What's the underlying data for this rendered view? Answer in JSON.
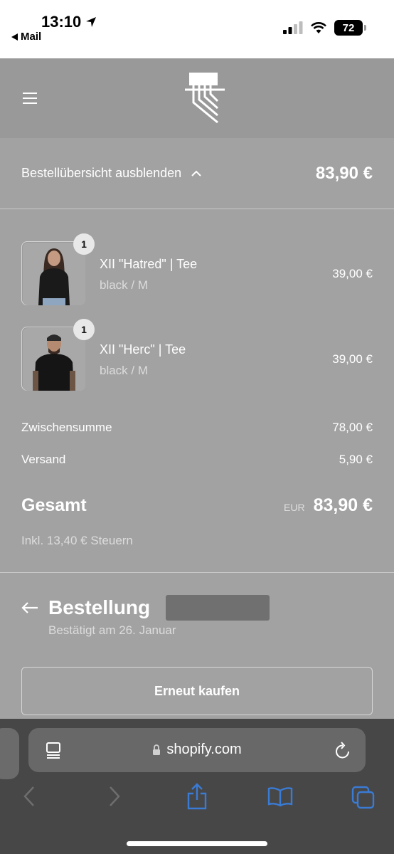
{
  "status_bar": {
    "time": "13:10",
    "back_app": "Mail",
    "battery": "72"
  },
  "header": {
    "menu_icon": "hamburger-icon",
    "logo": "brand-logo"
  },
  "summary": {
    "toggle_label": "Bestellübersicht ausblenden",
    "total": "83,90 €"
  },
  "items": [
    {
      "quantity": "1",
      "name": "XII \"Hatred\" | Tee",
      "variant": "black / M",
      "price": "39,00 €"
    },
    {
      "quantity": "1",
      "name": "XII \"Herc\" | Tee",
      "variant": "black / M",
      "price": "39,00 €"
    }
  ],
  "totals": {
    "subtotal_label": "Zwischensumme",
    "subtotal_value": "78,00 €",
    "shipping_label": "Versand",
    "shipping_value": "5,90 €",
    "total_label": "Gesamt",
    "currency": "EUR",
    "total_value": "83,90 €",
    "tax_note": "Inkl. 13,40 € Steuern"
  },
  "order": {
    "title": "Bestellung",
    "confirmed": "Bestätigt am 26. Januar",
    "rebuy_button": "Erneut kaufen"
  },
  "browser": {
    "url": "shopify.com",
    "accent": "#3a7bd5"
  }
}
